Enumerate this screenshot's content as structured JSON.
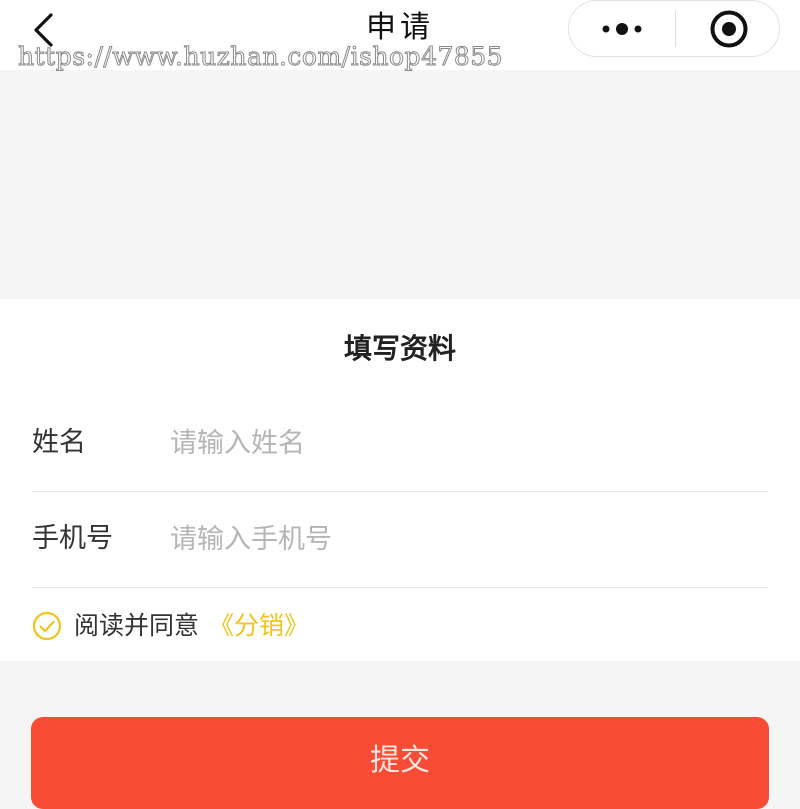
{
  "nav": {
    "title": "申请",
    "back_icon": "chevron-left-icon",
    "more_icon": "more-dots-icon",
    "close_icon": "target-circle-icon"
  },
  "watermark": {
    "text": "https://www.huzhan.com/ishop47855"
  },
  "form": {
    "heading": "填写资料",
    "name": {
      "label": "姓名",
      "value": "",
      "placeholder": "请输入姓名"
    },
    "phone": {
      "label": "手机号",
      "value": "",
      "placeholder": "请输入手机号"
    },
    "agreement": {
      "checked": true,
      "text": "阅读并同意",
      "link_text": "《分销》"
    }
  },
  "submit": {
    "label": "提交"
  },
  "colors": {
    "page_background": "#f5f5f5",
    "card_background": "#ffffff",
    "accent_yellow": "#f0c419",
    "submit_red": "#f84c36",
    "placeholder_gray": "#b5b5b5"
  }
}
